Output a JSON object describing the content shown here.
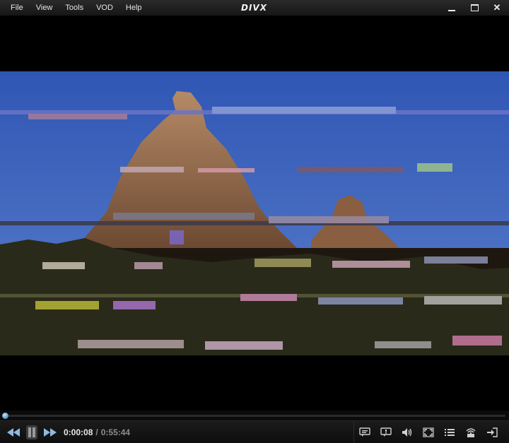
{
  "app": {
    "logo": "DIVX",
    "menu": [
      "File",
      "View",
      "Tools",
      "VOD",
      "Help"
    ]
  },
  "window_controls": [
    "minimize-icon",
    "maximize-icon",
    "close-icon"
  ],
  "playback": {
    "current_time": "0:00:08",
    "separator": "/",
    "duration": "0:55:44",
    "progress_fraction": 0.0024
  },
  "controls": {
    "left": [
      "rewind-icon",
      "pause-icon",
      "fast-forward-icon"
    ],
    "right": [
      "subtitles-icon",
      "chapters-icon",
      "volume-icon",
      "fullscreen-icon",
      "playlist-icon",
      "wireless-cast-icon",
      "exit-icon"
    ]
  },
  "colors": {
    "accent": "#3a7fb0",
    "sky": "#3c62b8",
    "rock": "#9a6a48"
  }
}
